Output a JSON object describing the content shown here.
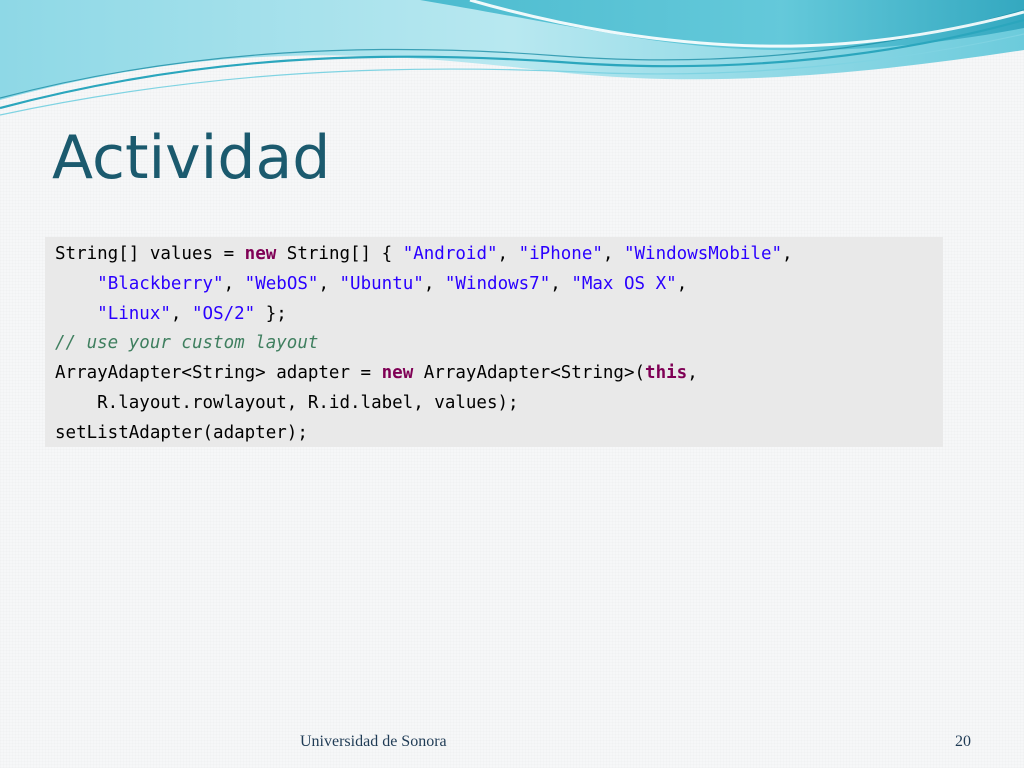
{
  "slide": {
    "title": "Actividad",
    "footer": "Universidad de Sonora",
    "page_number": "20"
  },
  "code": {
    "lines": [
      [
        {
          "type": "plain",
          "text": "String[] values = "
        },
        {
          "type": "keyword",
          "text": "new"
        },
        {
          "type": "plain",
          "text": " String[] { "
        },
        {
          "type": "string",
          "text": "\"Android\""
        },
        {
          "type": "plain",
          "text": ", "
        },
        {
          "type": "string",
          "text": "\"iPhone\""
        },
        {
          "type": "plain",
          "text": ", "
        },
        {
          "type": "string",
          "text": "\"WindowsMobile\""
        },
        {
          "type": "plain",
          "text": ","
        }
      ],
      [
        {
          "type": "plain",
          "text": "    "
        },
        {
          "type": "string",
          "text": "\"Blackberry\""
        },
        {
          "type": "plain",
          "text": ", "
        },
        {
          "type": "string",
          "text": "\"WebOS\""
        },
        {
          "type": "plain",
          "text": ", "
        },
        {
          "type": "string",
          "text": "\"Ubuntu\""
        },
        {
          "type": "plain",
          "text": ", "
        },
        {
          "type": "string",
          "text": "\"Windows7\""
        },
        {
          "type": "plain",
          "text": ", "
        },
        {
          "type": "string",
          "text": "\"Max OS X\""
        },
        {
          "type": "plain",
          "text": ","
        }
      ],
      [
        {
          "type": "plain",
          "text": "    "
        },
        {
          "type": "string",
          "text": "\"Linux\""
        },
        {
          "type": "plain",
          "text": ", "
        },
        {
          "type": "string",
          "text": "\"OS/2\""
        },
        {
          "type": "plain",
          "text": " };"
        }
      ],
      [
        {
          "type": "comment",
          "text": "// use your custom layout"
        }
      ],
      [
        {
          "type": "plain",
          "text": "ArrayAdapter<String> adapter = "
        },
        {
          "type": "keyword",
          "text": "new"
        },
        {
          "type": "plain",
          "text": " ArrayAdapter<String>("
        },
        {
          "type": "keyword",
          "text": "this"
        },
        {
          "type": "plain",
          "text": ","
        }
      ],
      [
        {
          "type": "plain",
          "text": "    R.layout.rowlayout, R.id.label, values);"
        }
      ],
      [
        {
          "type": "plain",
          "text": "setListAdapter(adapter);"
        }
      ]
    ]
  },
  "colors": {
    "title": "#1b5a6e",
    "keyword": "#7f0055",
    "string": "#2a00ff",
    "comment": "#3f7f5f",
    "code_background": "#e9e9e9",
    "wave_teal": "#4fc3d6",
    "wave_light": "#bfe9f1"
  }
}
